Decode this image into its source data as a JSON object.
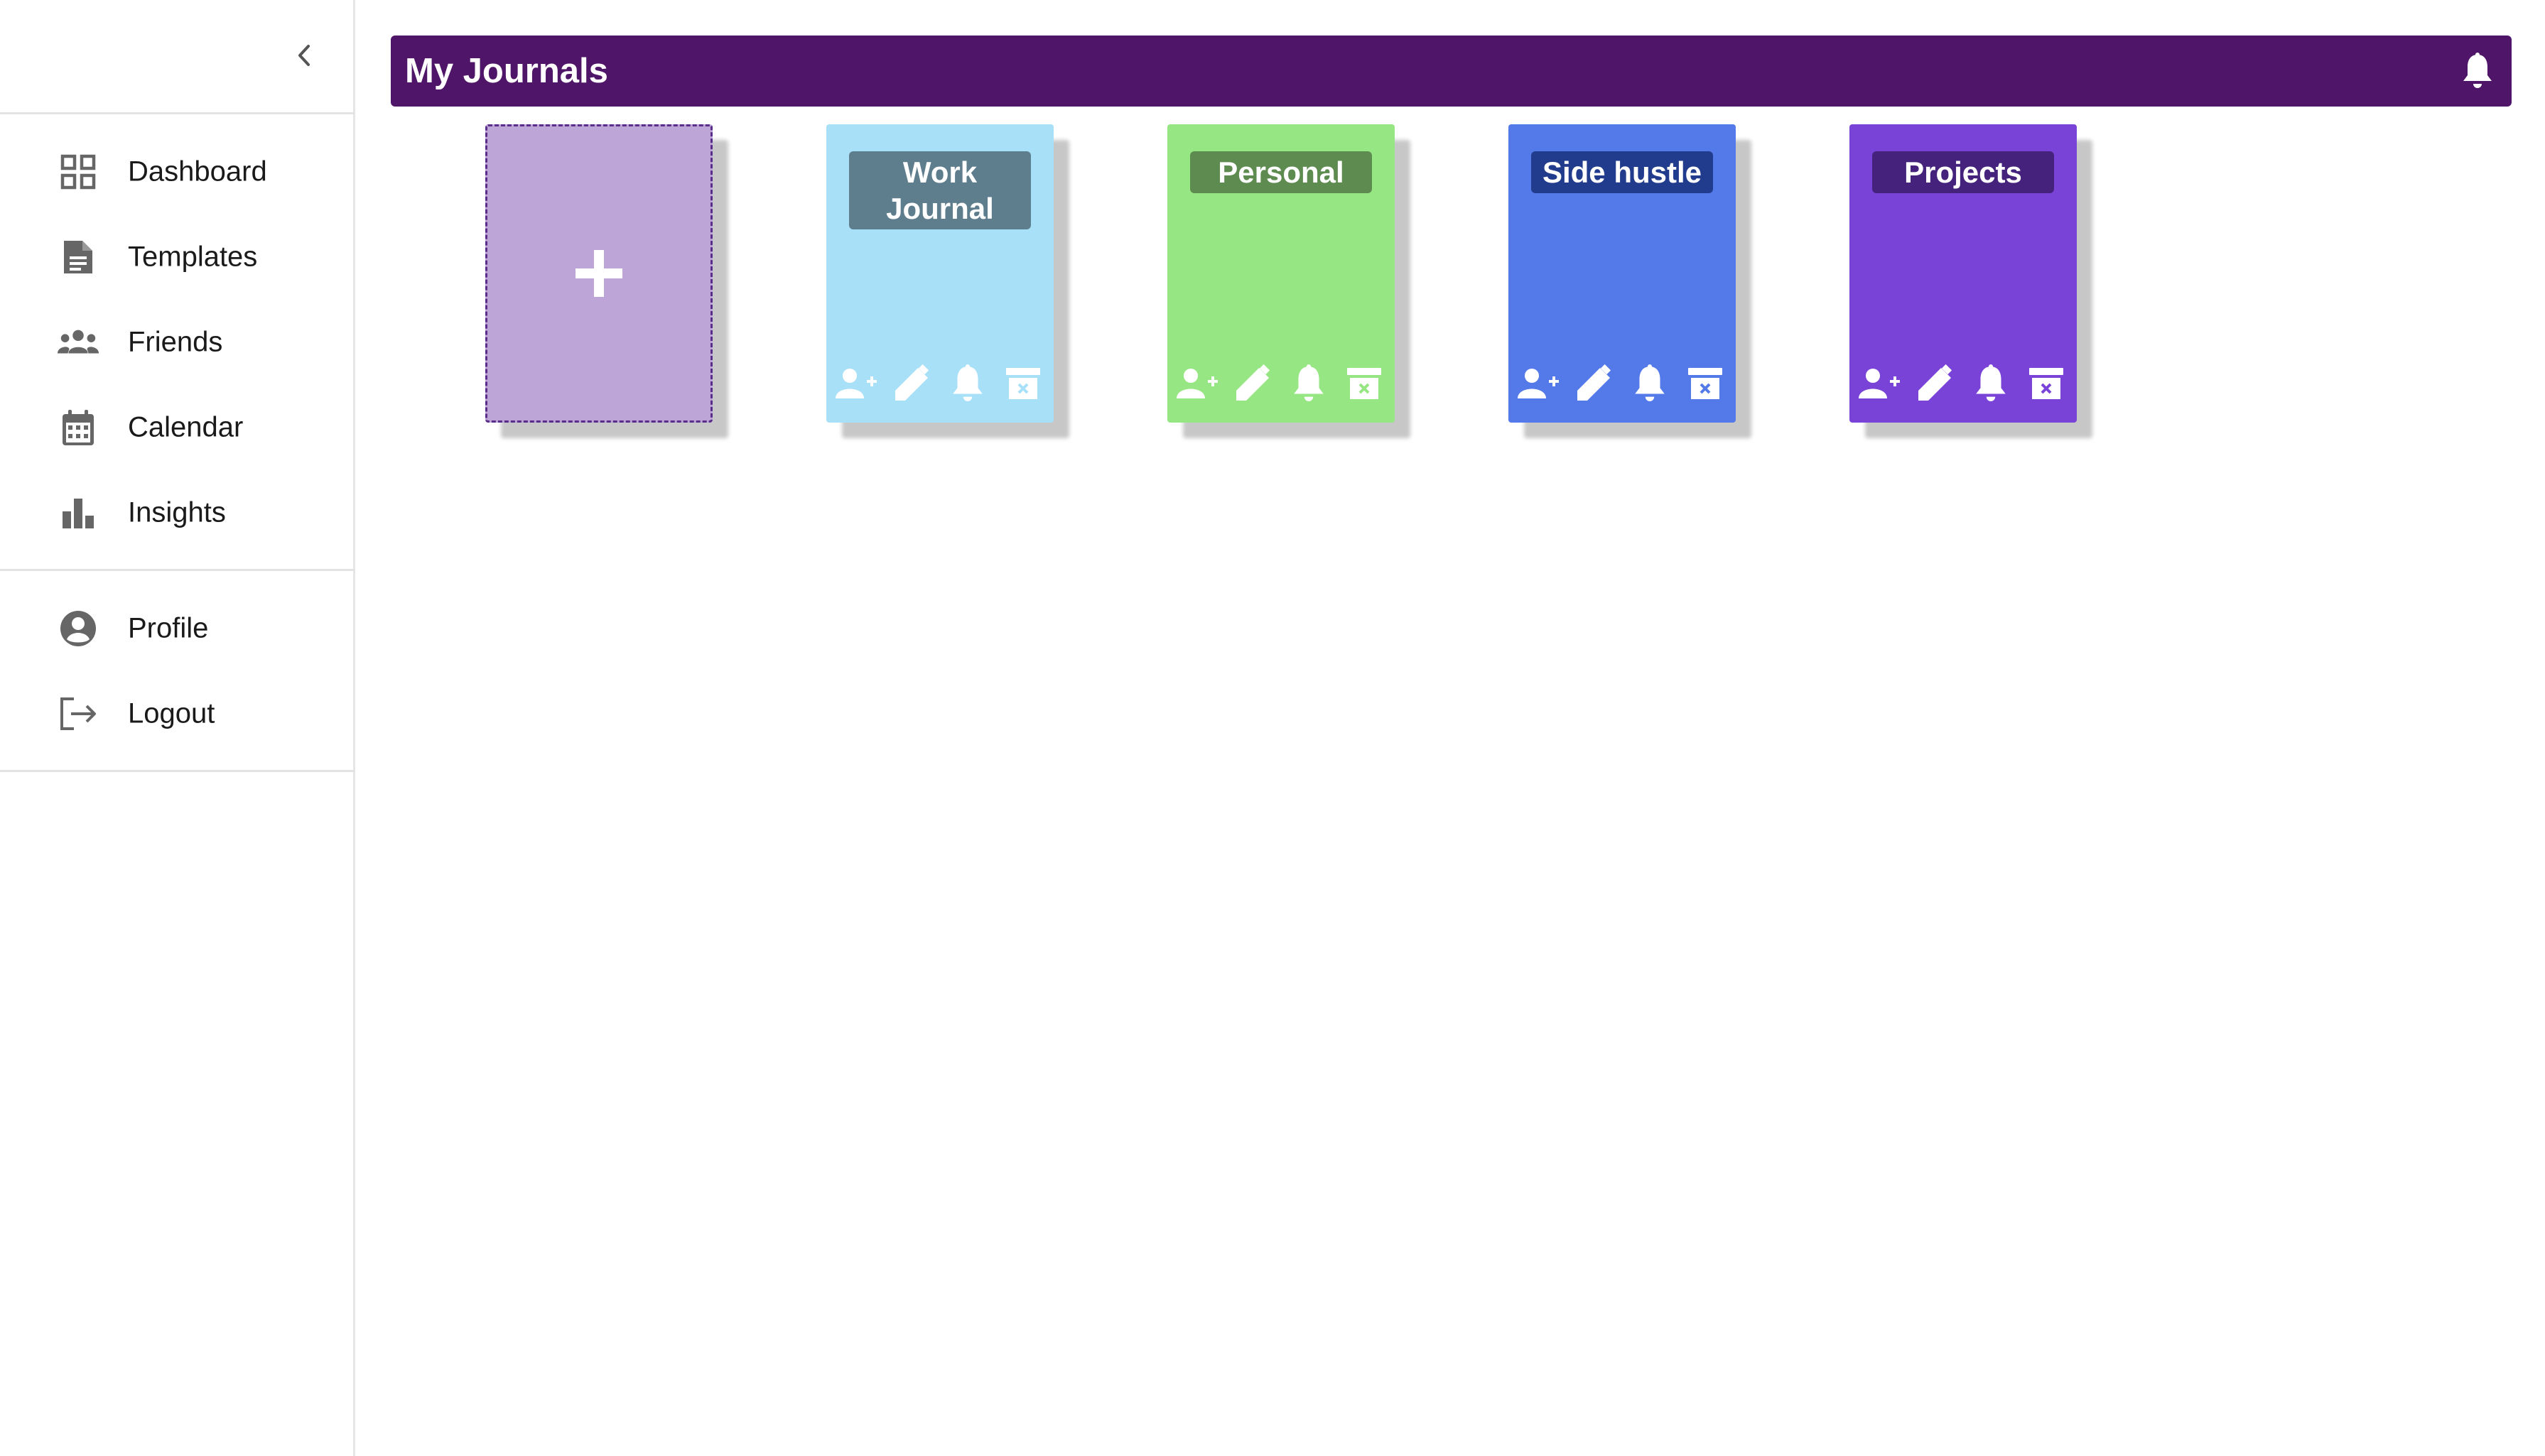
{
  "sidebar": {
    "collapse_icon": "chevron-left-icon",
    "main_items": [
      {
        "id": "dashboard",
        "label": "Dashboard",
        "icon": "grid-icon"
      },
      {
        "id": "templates",
        "label": "Templates",
        "icon": "document-icon"
      },
      {
        "id": "friends",
        "label": "Friends",
        "icon": "people-icon"
      },
      {
        "id": "calendar",
        "label": "Calendar",
        "icon": "calendar-icon"
      },
      {
        "id": "insights",
        "label": "Insights",
        "icon": "bar-chart-icon"
      }
    ],
    "account_items": [
      {
        "id": "profile",
        "label": "Profile",
        "icon": "account-circle-icon"
      },
      {
        "id": "logout",
        "label": "Logout",
        "icon": "logout-icon"
      }
    ],
    "icon_color": "#666666"
  },
  "header": {
    "title": "My Journals",
    "background": "#4f1568",
    "notification_icon": "bell-icon"
  },
  "journals": {
    "add_card": {
      "icon": "plus-icon",
      "color": "#bea5d7",
      "border_color": "#5a2d8a"
    },
    "items": [
      {
        "title": "Work Journal",
        "color": "#a8e0f8",
        "label_bg": "#5e7d8d"
      },
      {
        "title": "Personal",
        "color": "#96e683",
        "label_bg": "#5e8b4f"
      },
      {
        "title": "Side hustle",
        "color": "#5479e8",
        "label_bg": "#213c8c"
      },
      {
        "title": "Projects",
        "color": "#7a43d8",
        "label_bg": "#45227c"
      }
    ],
    "actions": [
      "add-friend-icon",
      "pencil-icon",
      "bell-icon",
      "archive-delete-icon"
    ]
  }
}
